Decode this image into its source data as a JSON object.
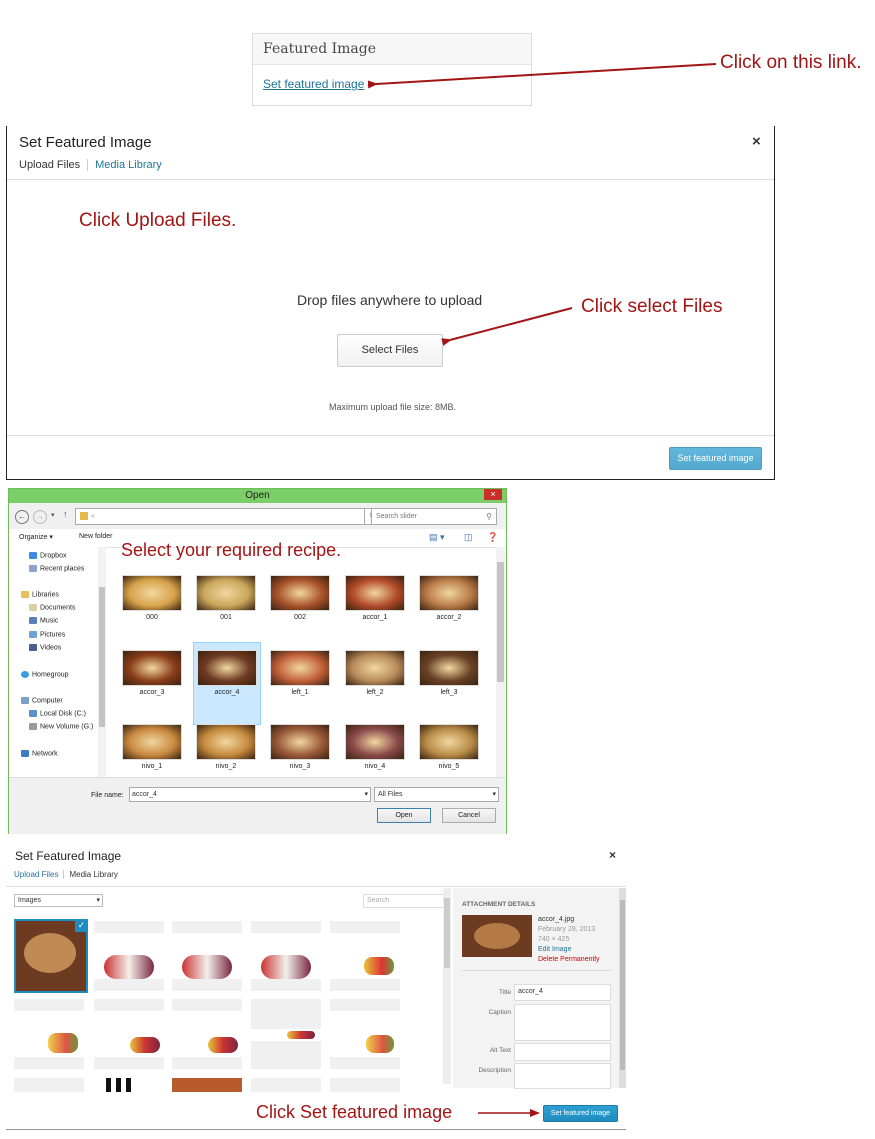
{
  "featured_box": {
    "heading": "Featured Image",
    "link": "Set featured image"
  },
  "annotations": {
    "click_link": "Click on this link.",
    "click_upload": "Click Upload Files.",
    "click_select": "Click select Files",
    "select_recipe": "Select your required recipe.",
    "click_set": "Click Set featured image"
  },
  "upload_modal": {
    "title": "Set Featured Image",
    "close": "×",
    "tabs": [
      "Upload Files",
      "Media Library"
    ],
    "drop_text": "Drop files anywhere to upload",
    "select_button": "Select Files",
    "max_size": "Maximum upload file size: 8MB.",
    "set_button": "Set featured image"
  },
  "open_dialog": {
    "title": "Open",
    "close": "×",
    "address_prefix": "«",
    "search_placeholder": "Search slider",
    "organize": "Organize ▾",
    "new_folder": "New folder",
    "nav": {
      "dropbox": "Dropbox",
      "recent": "Recent places",
      "libraries": "Libraries",
      "documents": "Documents",
      "music": "Music",
      "pictures": "Pictures",
      "videos": "Videos",
      "homegroup": "Homegroup",
      "computer": "Computer",
      "local_disk": "Local Disk (C:)",
      "new_volume": "New Volume (G:)",
      "network": "Network"
    },
    "files": [
      {
        "name": "000",
        "color": "#d7a34a"
      },
      {
        "name": "001",
        "color": "#c9a65a"
      },
      {
        "name": "002",
        "color": "#a8522a"
      },
      {
        "name": "accor_1",
        "color": "#b24a2a"
      },
      {
        "name": "accor_2",
        "color": "#b97a48"
      },
      {
        "name": "accor_3",
        "color": "#8a3e1a"
      },
      {
        "name": "accor_4",
        "color": "#6d3a22",
        "selected": true
      },
      {
        "name": "left_1",
        "color": "#c1603a"
      },
      {
        "name": "left_2",
        "color": "#b88a5a"
      },
      {
        "name": "left_3",
        "color": "#6a4226"
      },
      {
        "name": "nivo_1",
        "color": "#c98a40"
      },
      {
        "name": "nivo_2",
        "color": "#c58a3e"
      },
      {
        "name": "nivo_3",
        "color": "#9a5a3a"
      },
      {
        "name": "nivo_4",
        "color": "#8a4a4a"
      },
      {
        "name": "nivo_5",
        "color": "#b98c48"
      }
    ],
    "file_name_label": "File name:",
    "file_name_value": "accor_4",
    "file_type": "All Files",
    "open_button": "Open",
    "cancel_button": "Cancel"
  },
  "media_modal": {
    "title": "Set Featured Image",
    "close": "×",
    "tabs": [
      "Upload Files",
      "Media Library"
    ],
    "filter": "Images",
    "search_placeholder": "Search",
    "attachment": {
      "heading": "ATTACHMENT DETAILS",
      "filename": "accor_4.jpg",
      "date": "February 28, 2013",
      "dimensions": "740 × 425",
      "edit": "Edit Image",
      "delete": "Delete Permanently",
      "title_label": "Title",
      "title_value": "accor_4",
      "caption_label": "Caption",
      "alt_label": "Alt Text",
      "description_label": "Description"
    },
    "set_button": "Set featured image"
  },
  "colors": {
    "annotation": "#a31515",
    "link": "#21759b",
    "primary": "#1e8cbe",
    "win_titlebar": "#7ccf68"
  }
}
